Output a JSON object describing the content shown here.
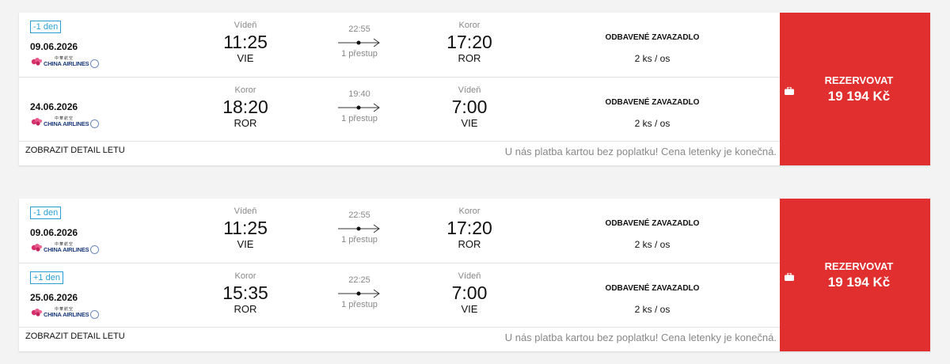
{
  "results": [
    {
      "legs": [
        {
          "badge": "-1 den",
          "date": "09.06.2026",
          "airline": "CHINA AIRLINES",
          "airline_cn": "中華航空",
          "from_city": "Vídeň",
          "dep_time": "11:25",
          "from_code": "VIE",
          "duration": "22:55",
          "stops": "1 přestup",
          "to_city": "Koror",
          "arr_time": "17:20",
          "to_code": "ROR",
          "baggage_title": "ODBAVENÉ ZAVAZADLO",
          "baggage_value": "2 ks / os"
        },
        {
          "badge": "",
          "date": "24.06.2026",
          "airline": "CHINA AIRLINES",
          "airline_cn": "中華航空",
          "from_city": "Koror",
          "dep_time": "18:20",
          "from_code": "ROR",
          "duration": "19:40",
          "stops": "1 přestup",
          "to_city": "Vídeň",
          "arr_time": "7:00",
          "to_code": "VIE",
          "baggage_title": "ODBAVENÉ ZAVAZADLO",
          "baggage_value": "2 ks / os"
        }
      ],
      "detail_label": "ZOBRAZIT DETAIL LETU",
      "note": "U nás platba kartou bez poplatku! Cena letenky je konečná.",
      "book_label": "REZERVOVAT",
      "price": "19 194 Kč"
    },
    {
      "legs": [
        {
          "badge": "-1 den",
          "date": "09.06.2026",
          "airline": "CHINA AIRLINES",
          "airline_cn": "中華航空",
          "from_city": "Vídeň",
          "dep_time": "11:25",
          "from_code": "VIE",
          "duration": "22:55",
          "stops": "1 přestup",
          "to_city": "Koror",
          "arr_time": "17:20",
          "to_code": "ROR",
          "baggage_title": "ODBAVENÉ ZAVAZADLO",
          "baggage_value": "2 ks / os"
        },
        {
          "badge": "+1 den",
          "date": "25.06.2026",
          "airline": "CHINA AIRLINES",
          "airline_cn": "中華航空",
          "from_city": "Koror",
          "dep_time": "15:35",
          "from_code": "ROR",
          "duration": "22:25",
          "stops": "1 přestup",
          "to_city": "Vídeň",
          "arr_time": "7:00",
          "to_code": "VIE",
          "baggage_title": "ODBAVENÉ ZAVAZADLO",
          "baggage_value": "2 ks / os"
        }
      ],
      "detail_label": "ZOBRAZIT DETAIL LETU",
      "note": "U nás platba kartou bez poplatku! Cena letenky je konečná.",
      "book_label": "REZERVOVAT",
      "price": "19 194 Kč"
    }
  ],
  "colors": {
    "accent": "#e12e2e",
    "badge": "#2a9fd6",
    "muted": "#888888"
  },
  "icons": {
    "book": "suitcase-icon",
    "route": "arrow-right-icon",
    "airline": "china-airlines-logo"
  }
}
